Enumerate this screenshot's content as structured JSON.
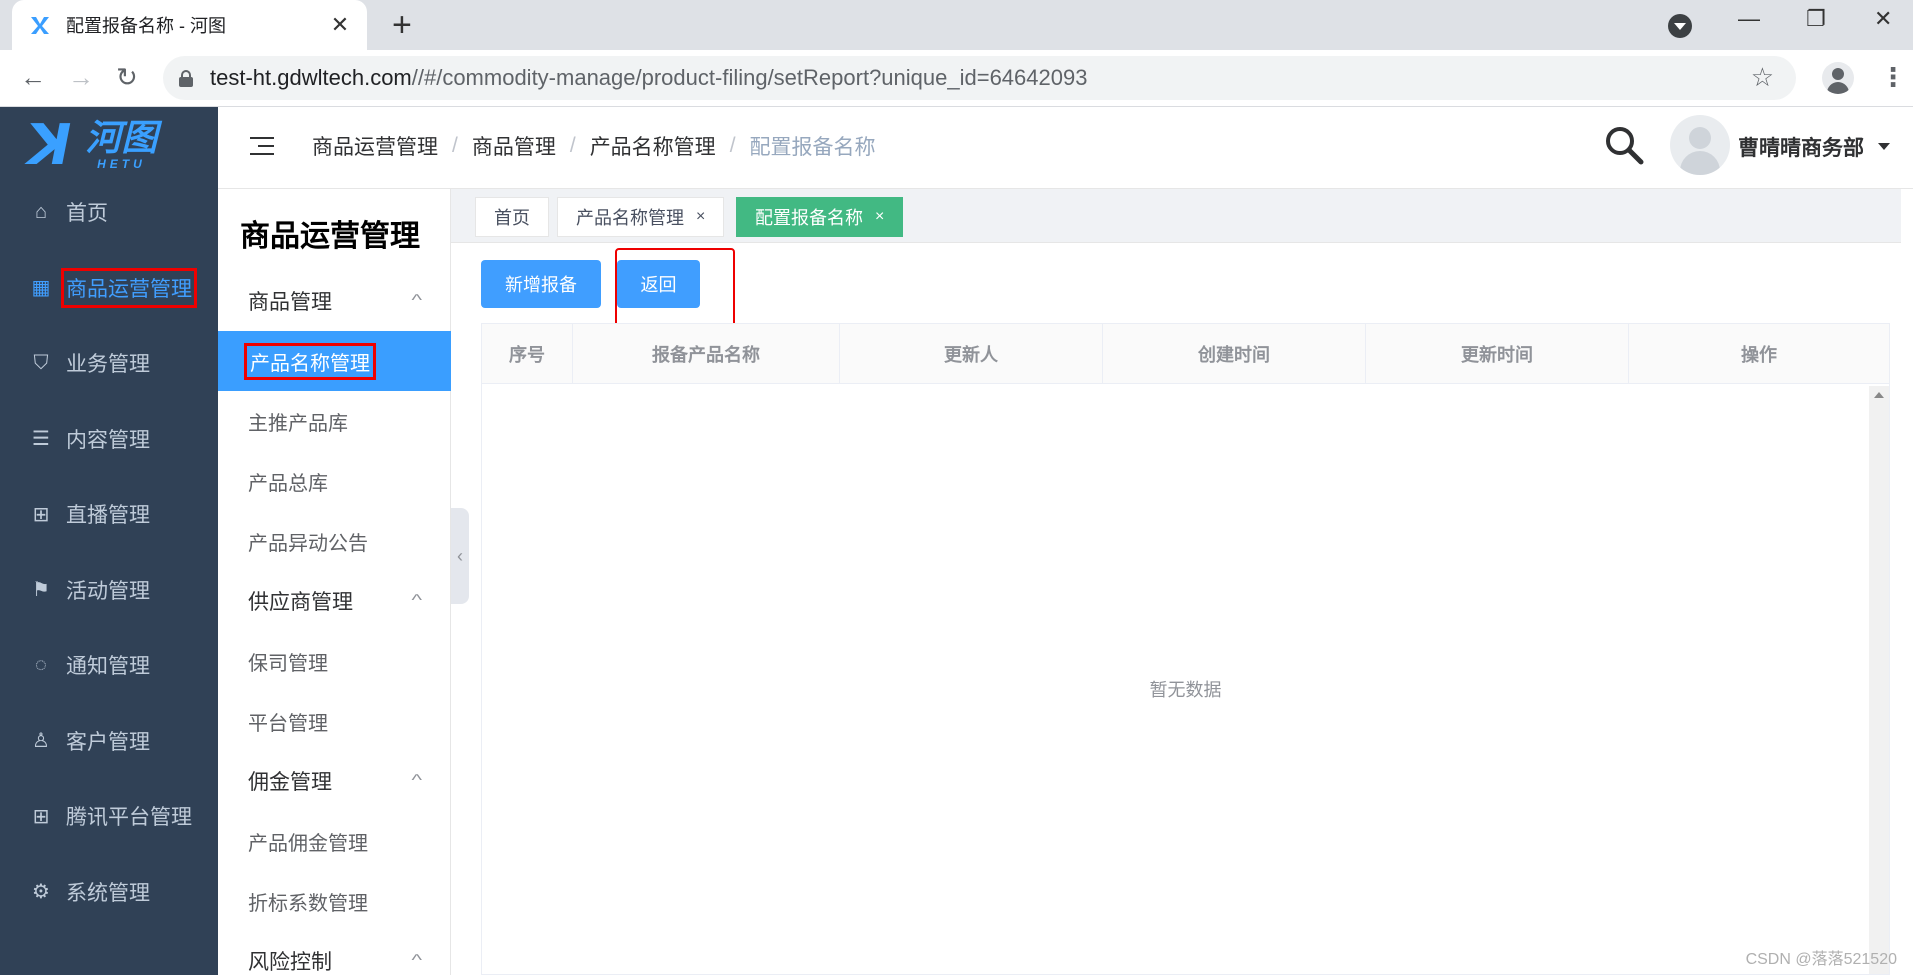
{
  "browser": {
    "tab_title": "配置报备名称 - 河图",
    "tab_close": "✕",
    "new_tab": "+",
    "url_host": "test-ht.gdwltech.com",
    "url_rest": "//#/commodity-manage/product-filing/setReport?unique_id=64642093"
  },
  "logo": {
    "cn": "河图",
    "en": "HETU"
  },
  "sidebar": {
    "items": [
      {
        "label": "首页",
        "icon": "home-icon"
      },
      {
        "label": "商品运营管理",
        "icon": "chart-icon"
      },
      {
        "label": "业务管理",
        "icon": "shield-icon"
      },
      {
        "label": "内容管理",
        "icon": "list-icon"
      },
      {
        "label": "直播管理",
        "icon": "grid-icon"
      },
      {
        "label": "活动管理",
        "icon": "flag-icon"
      },
      {
        "label": "通知管理",
        "icon": "chat-icon"
      },
      {
        "label": "客户管理",
        "icon": "user-icon"
      },
      {
        "label": "腾讯平台管理",
        "icon": "apps-icon"
      },
      {
        "label": "系统管理",
        "icon": "gear-icon"
      }
    ],
    "active_index": 1
  },
  "submenu": {
    "title": "商品运营管理",
    "groups": [
      {
        "label": "商品管理",
        "items": [
          "产品名称管理",
          "主推产品库",
          "产品总库",
          "产品异动公告"
        ]
      },
      {
        "label": "供应商管理",
        "items": [
          "保司管理",
          "平台管理"
        ]
      },
      {
        "label": "佣金管理",
        "items": [
          "产品佣金管理",
          "折标系数管理"
        ]
      },
      {
        "label": "风险控制",
        "items": []
      }
    ],
    "active_item": "产品名称管理"
  },
  "breadcrumb": [
    "商品运营管理",
    "商品管理",
    "产品名称管理",
    "配置报备名称"
  ],
  "user": {
    "name": "曹晴晴商务部"
  },
  "tags": [
    {
      "label": "首页",
      "closable": false
    },
    {
      "label": "产品名称管理",
      "closable": true
    },
    {
      "label": "配置报备名称",
      "closable": true,
      "active": true
    }
  ],
  "actions": {
    "add_label": "新增报备",
    "back_label": "返回"
  },
  "table": {
    "columns": [
      "序号",
      "报备产品名称",
      "更新人",
      "创建时间",
      "更新时间",
      "操作"
    ],
    "rows": [],
    "empty_text": "暂无数据"
  },
  "watermark": "CSDN @落落521520",
  "colors": {
    "accent": "#409eff",
    "tag_active": "#42b983",
    "sidebar_bg": "#304156",
    "highlight": "#e00000"
  }
}
